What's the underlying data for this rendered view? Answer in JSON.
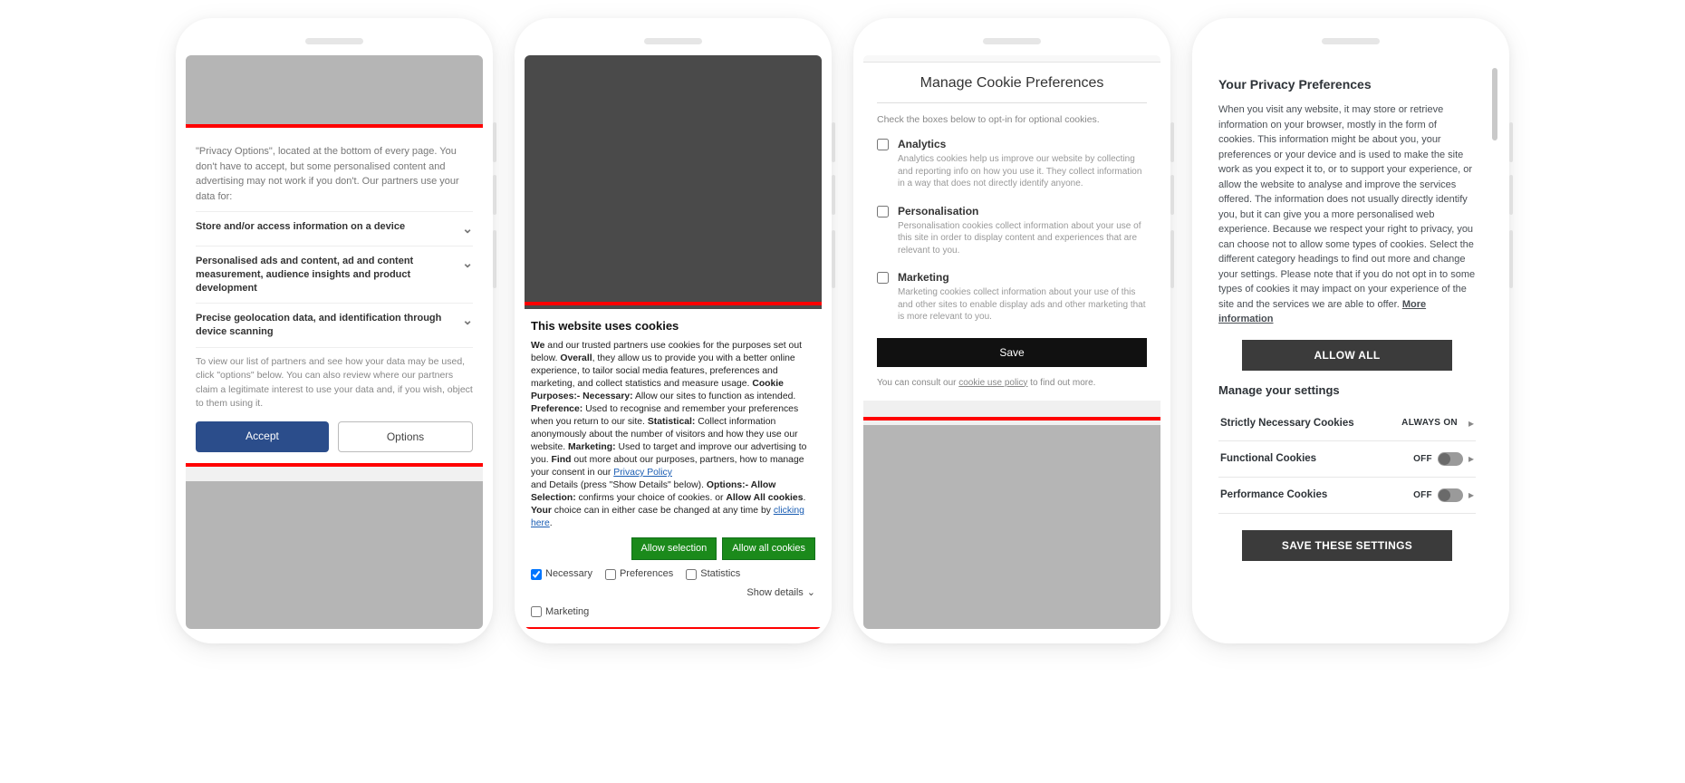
{
  "phone1": {
    "intro": "\"Privacy Options\", located at the bottom of every page. You don't have to accept, but some personalised content and advertising may not work if you don't. Our partners use your data for:",
    "rows": [
      "Store and/or access information on a device",
      "Personalised ads and content, ad and content measurement, audience insights and product development",
      "Precise geolocation data, and identification through device scanning"
    ],
    "note": "To view our list of partners and see how your data may be used, click \"options\" below. You can also review where our partners claim a legitimate interest to use your data and, if you wish, object to them using it.",
    "accept": "Accept",
    "options": "Options"
  },
  "phone2": {
    "title": "This website uses cookies",
    "allow_selection": "Allow selection",
    "allow_all": "Allow all cookies",
    "checks": {
      "necessary": "Necessary",
      "preferences": "Preferences",
      "statistics": "Statistics",
      "marketing": "Marketing"
    },
    "show_details": "Show details",
    "body_parts": {
      "we": "We",
      "t1": " and our trusted partners use cookies for the purposes set out below. ",
      "overall": "Overall",
      "t2": ", they allow us to provide you with a better online experience, to tailor social media features, preferences and marketing, and collect statistics and measure usage. ",
      "cookie_purposes": "Cookie Purposes:- Necessary:",
      "t3": " Allow our sites to function as intended. ",
      "preference": "Preference:",
      "t4": " Used to recognise and remember your preferences when you return to our site. ",
      "statistical": "Statistical:",
      "t5": " Collect information anonymously about the number of visitors and how they use our website. ",
      "marketing": "Marketing:",
      "t6": " Used to target and improve our advertising to you. ",
      "find": "Find",
      "t7": " out more about our purposes, partners, how to manage your consent in our ",
      "pp": "Privacy Policy",
      "t8": " and Details (press \"Show Details\" below). ",
      "options": "Options:- Allow Selection:",
      "t9": " confirms your choice of cookies. or ",
      "allow_all_b": "Allow All cookies",
      "t10": ". ",
      "your": "Your",
      "t11": " choice can in either case be changed at any time by ",
      "clicking_here": "clicking here",
      "dot": "."
    }
  },
  "phone3": {
    "title": "Manage Cookie Preferences",
    "intro": "Check the boxes below to opt-in for optional cookies.",
    "items": [
      {
        "label": "Analytics",
        "desc": "Analytics cookies help us improve our website by collecting and reporting info on how you use it. They collect information in a way that does not directly identify anyone."
      },
      {
        "label": "Personalisation",
        "desc": "Personalisation cookies collect information about your use of this site in order to display content and experiences that are relevant to you."
      },
      {
        "label": "Marketing",
        "desc": "Marketing cookies collect information about your use of this and other sites to enable display ads and other marketing that is more relevant to you."
      }
    ],
    "save": "Save",
    "footer_pre": "You can consult our ",
    "footer_link": "cookie use policy",
    "footer_post": " to find out more."
  },
  "phone4": {
    "title": "Your Privacy Preferences",
    "body": "When you visit any website, it may store or retrieve information on your browser, mostly in the form of cookies. This information might be about you, your preferences or your device and is used to make the site work as you expect it to, or to support your experience, or allow the website to analyse and improve the services offered. The information does not usually directly identify you, but it can give you a more personalised web experience. Because we respect your right to privacy, you can choose not to allow some types of cookies. Select the different category headings to find out more and change your settings. Please note that if you do not opt in to some types of cookies it may impact on your experience of the site and the services we are able to offer.  ",
    "more": "More information",
    "allow_all": "ALLOW ALL",
    "manage": "Manage your settings",
    "rows": [
      {
        "name": "Strictly Necessary Cookies",
        "state": "ALWAYS ON",
        "toggle": false
      },
      {
        "name": "Functional Cookies",
        "state": "OFF",
        "toggle": true
      },
      {
        "name": "Performance Cookies",
        "state": "OFF",
        "toggle": true
      }
    ],
    "save": "SAVE THESE SETTINGS"
  }
}
